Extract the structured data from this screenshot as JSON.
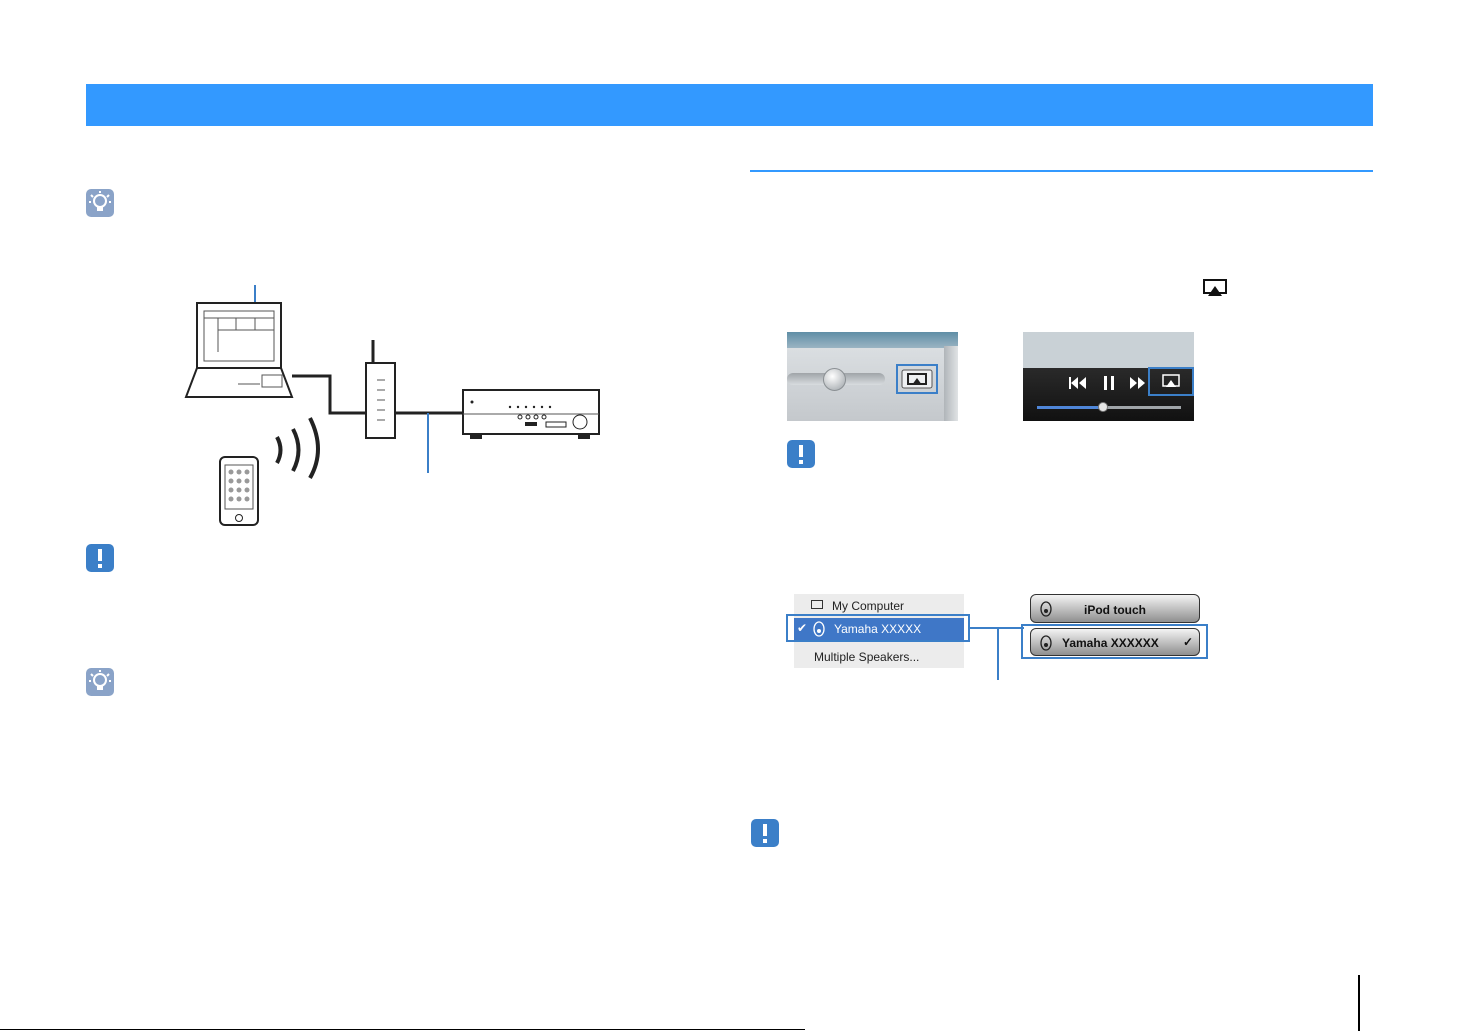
{
  "colors": {
    "accent": "#3399ff",
    "note_icon": "#3b7fc8",
    "hint_icon": "#8aa3c8"
  },
  "icons": {
    "hint": "lightbulb-icon",
    "note": "exclamation-icon",
    "airplay": "airplay-icon"
  },
  "speaker_menu": {
    "items": [
      {
        "label": "My Computer",
        "checked": false
      },
      {
        "label": "Yamaha  XXXXX",
        "checked": true
      },
      {
        "label": "Multiple Speakers..."
      }
    ]
  },
  "ios_menu": {
    "items": [
      {
        "label": "iPod touch"
      },
      {
        "label": "Yamaha XXXXXX",
        "checked": true
      }
    ]
  }
}
